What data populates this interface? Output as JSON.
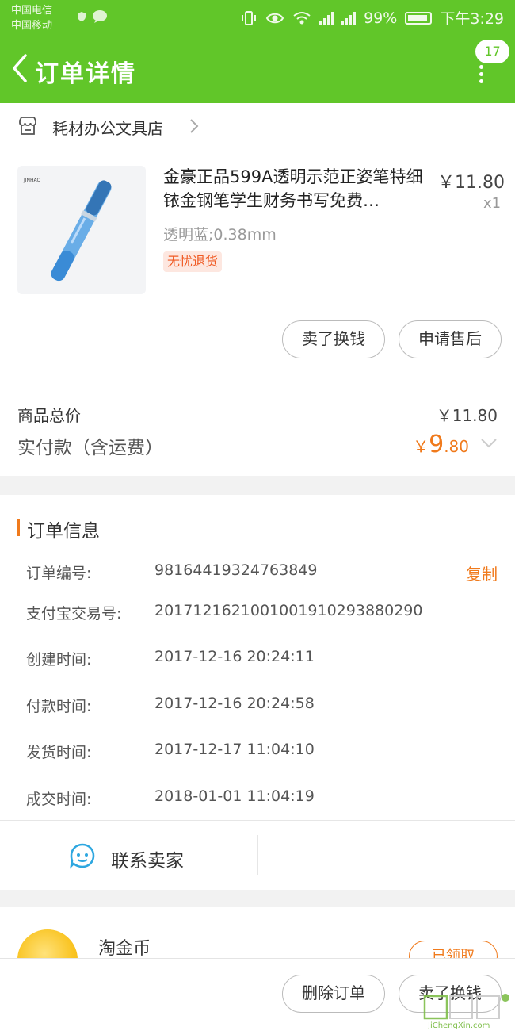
{
  "status_bar": {
    "carrier1": "中国电信",
    "carrier2": "中国移动",
    "battery": "99%",
    "time": "下午3:29"
  },
  "header": {
    "title": "订单详情",
    "badge_count": "17",
    "bg_color": "#61c629"
  },
  "store": {
    "name": "耗材办公文具店"
  },
  "product": {
    "title": "金豪正品599A透明示范正姿笔特细铱金钢笔学生财务书写免费…",
    "price": "￥11.80",
    "quantity": "x1",
    "spec": "透明蓝;0.38mm",
    "tag": "无忧退货"
  },
  "item_actions": {
    "sell": "卖了换钱",
    "after_sale": "申请售后"
  },
  "summary": {
    "total_label": "商品总价",
    "total_value": "￥11.80",
    "paid_label": "实付款（含运费）",
    "paid_currency": "￥",
    "paid_int": "9",
    "paid_dec": ".80"
  },
  "order_info": {
    "title": "订单信息",
    "copy_label": "复制",
    "rows": [
      {
        "label": "订单编号:",
        "value": "98164419324763849"
      },
      {
        "label": "支付宝交易号:",
        "value": "2017121621001001910293880290"
      },
      {
        "label": "创建时间:",
        "value": "2017-12-16 20:24:11"
      },
      {
        "label": "付款时间:",
        "value": "2017-12-16 20:24:58"
      },
      {
        "label": "发货时间:",
        "value": "2017-12-17 11:04:10"
      },
      {
        "label": "成交时间:",
        "value": "2018-01-01 11:04:19"
      }
    ]
  },
  "contact": {
    "label": "联系卖家"
  },
  "coins": {
    "title": "淘金币",
    "claimed": "已领取"
  },
  "bottom_actions": {
    "delete": "删除订单",
    "sell": "卖了换钱"
  },
  "watermark": {
    "text": "JiChengXin.com"
  },
  "accent_color": "#f07a1c"
}
